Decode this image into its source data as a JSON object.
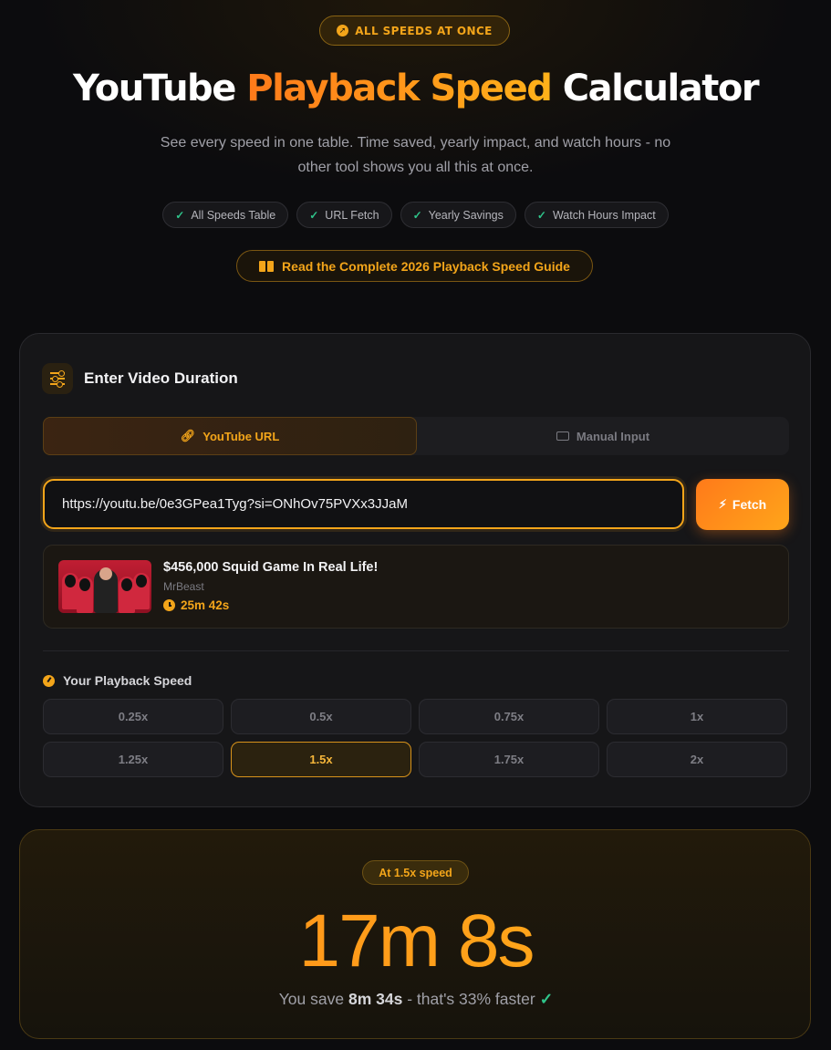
{
  "header": {
    "badge": "ALL SPEEDS AT ONCE",
    "title_part1": "YouTube",
    "title_part2": "Playback Speed",
    "title_part3": "Calculator",
    "subtitle": "See every speed in one table. Time saved, yearly impact, and watch hours - no other tool shows you all this at once.",
    "features": [
      "All Speeds Table",
      "URL Fetch",
      "Yearly Savings",
      "Watch Hours Impact"
    ],
    "guide_link": "Read the Complete 2026 Playback Speed Guide"
  },
  "input_card": {
    "title": "Enter Video Duration",
    "tabs": [
      {
        "label": "YouTube URL",
        "active": true
      },
      {
        "label": "Manual Input",
        "active": false
      }
    ],
    "url_value": "https://youtu.be/0e3GPea1Tyg?si=ONhOv75PVXx3JJaM",
    "fetch_label": "Fetch",
    "video": {
      "title": "$456,000 Squid Game In Real Life!",
      "channel": "MrBeast",
      "duration": "25m 42s"
    },
    "speed_label": "Your Playback Speed",
    "speeds": [
      "0.25x",
      "0.5x",
      "0.75x",
      "1x",
      "1.25x",
      "1.5x",
      "1.75x",
      "2x"
    ],
    "selected_speed": "1.5x"
  },
  "result": {
    "badge": "At 1.5x speed",
    "time": "17m 8s",
    "save_prefix": "You save",
    "save_amount": "8m 34s",
    "save_suffix": "- that's 33% faster"
  },
  "colors": {
    "accent": "#f3a51a",
    "accent_orange": "#ff7a1a",
    "success": "#2fc48a",
    "background": "#0c0c0e",
    "card": "#161618"
  }
}
